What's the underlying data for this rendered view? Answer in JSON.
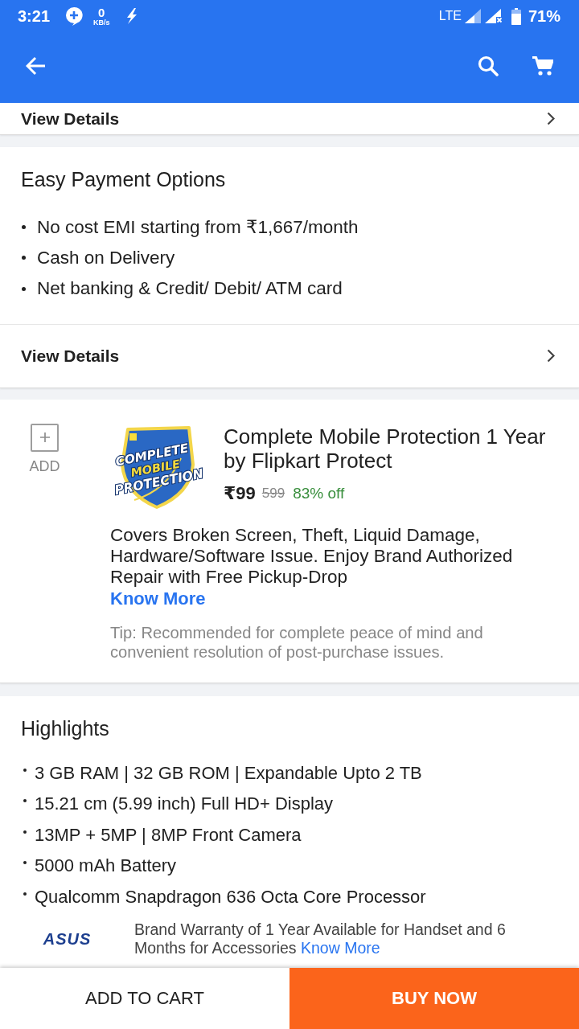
{
  "status_bar": {
    "time": "3:21",
    "net_speed": "0",
    "net_speed_unit": "KB/s",
    "network": "LTE",
    "battery": "71%"
  },
  "top_link": {
    "label": "View Details"
  },
  "payment_options": {
    "title": "Easy Payment Options",
    "items": [
      "No cost EMI starting from ₹1,667/month",
      "Cash on Delivery",
      "Net banking & Credit/ Debit/ ATM card"
    ],
    "link": "View Details"
  },
  "protection_offer": {
    "add_label": "ADD",
    "logo_lines": [
      "COMPLETE",
      "MOBILE",
      "PROTECTION"
    ],
    "title": "Complete Mobile Protection 1 Year by Flipkart Protect",
    "price": "₹99",
    "original_price": "599",
    "discount": "83% off",
    "description": "Covers Broken Screen, Theft, Liquid Damage, Hardware/Software Issue. Enjoy Brand Authorized Repair with Free Pickup-Drop",
    "link": "Know More",
    "tip": "Tip: Recommended for complete peace of mind and convenient resolution of post-purchase issues."
  },
  "highlights": {
    "title": "Highlights",
    "items": [
      "3 GB RAM | 32 GB ROM | Expandable Upto 2 TB",
      "15.21 cm (5.99 inch) Full HD+ Display",
      "13MP + 5MP | 8MP Front Camera",
      "5000 mAh Battery",
      "Qualcomm Snapdragon 636 Octa Core Processor"
    ],
    "warranty": {
      "brand_logo": "ASUS",
      "text": "Brand Warranty of 1 Year Available for Handset and 6 Months for Accessories",
      "link": "Know More"
    }
  },
  "actions": [
    {
      "label": "ADD TO CART",
      "kind": "secondary"
    },
    {
      "label": "BUY NOW",
      "kind": "primary"
    }
  ]
}
